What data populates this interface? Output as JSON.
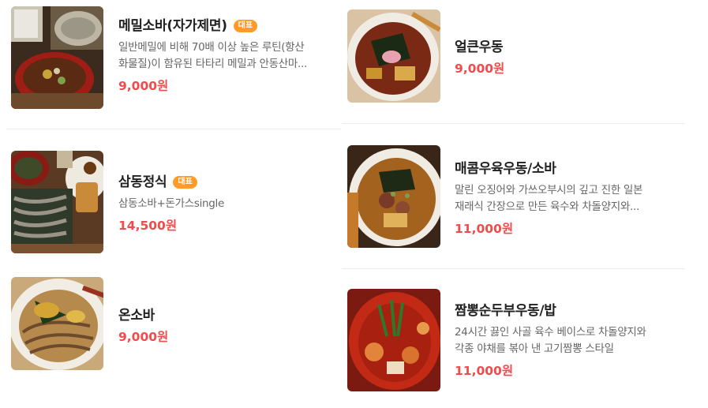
{
  "colors": {
    "accent_price": "#f24b4b",
    "badge_bg": "#ff9b26"
  },
  "menu_left": [
    {
      "name": "메밀소바(자가제면)",
      "badge": "대표",
      "desc_line1": "일반메밀에 비해 70배 이상 높은 루틴(항산",
      "desc_line2": "화물질)이 함유된 타타리 메밀과 안동산마...",
      "price": "9,000원",
      "image": "soba-with-dipping-broth"
    },
    {
      "name": "삼동정식",
      "badge": "대표",
      "desc_line1": "삼동소바+돈가스single",
      "price": "14,500원",
      "image": "soba-and-tonkatsu-set"
    },
    {
      "name": "온소바",
      "price": "9,000원",
      "image": "warm-soba-bowl"
    }
  ],
  "menu_right": [
    {
      "name": "얼큰우동",
      "price": "9,000원",
      "image": "spicy-udon-bowl"
    },
    {
      "name": "매콤우육우동/소바",
      "desc_line1": "말린 오징어와 가쓰오부시의 깊고 진한 일본",
      "desc_line2": "재래식 간장으로 만든 육수와 차돌양지와...",
      "price": "11,000원",
      "image": "spicy-beef-udon-bowl"
    },
    {
      "name": "짬뽕순두부우동/밥",
      "desc_line1": "24시간 끓인 사골 육수 베이스로 차돌양지와",
      "desc_line2": "각종 야채를 볶아 낸 고기짬뽕 스타일",
      "price": "11,000원",
      "image": "jjamppong-soft-tofu-udon"
    }
  ]
}
